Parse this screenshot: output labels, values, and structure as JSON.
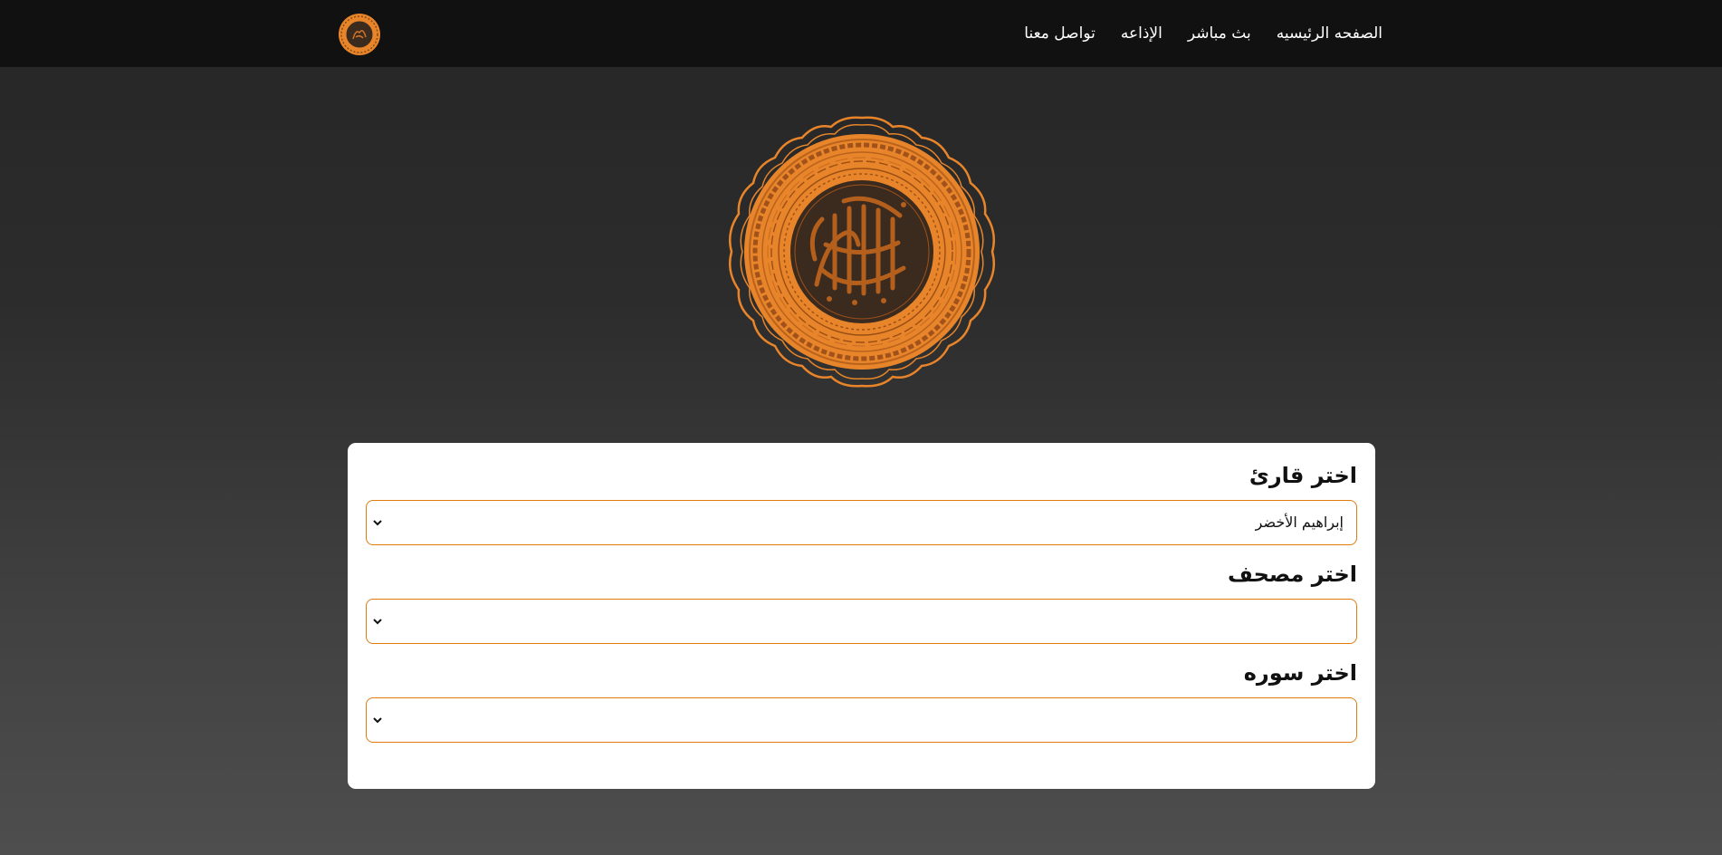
{
  "nav": {
    "links": [
      {
        "label": "الصفحه الرئيسيه"
      },
      {
        "label": "بث مباشر"
      },
      {
        "label": "الإذاعه"
      },
      {
        "label": "تواصل معنا"
      }
    ]
  },
  "form": {
    "reciter": {
      "title": "اختر قارئ",
      "value": "إبراهيم الأخضر"
    },
    "mushaf": {
      "title": "اختر مصحف",
      "value": ""
    },
    "surah": {
      "title": "اختر سوره",
      "value": ""
    }
  },
  "colors": {
    "accent": "#e07b12",
    "navbar": "#111111",
    "logo_orange": "#e8852a",
    "logo_dark": "#3b2a1e"
  },
  "icons": {
    "brand": "quran-emblem-icon",
    "dropdown": "chevron-down-icon"
  }
}
